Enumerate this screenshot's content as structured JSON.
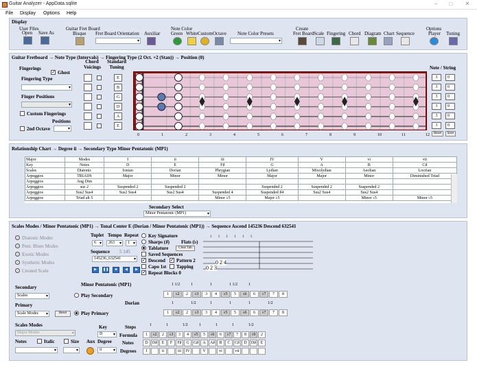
{
  "window": {
    "title": "Guitar Analyzer - AppData.sqlite"
  },
  "menu": [
    "File",
    "Display",
    "Options",
    "Help"
  ],
  "display": {
    "label": "Display",
    "user_files": "User Files",
    "open": "Open",
    "save_as": "Save As",
    "fretboard_group": "Guitar Fret Board",
    "bisque": "Bisque",
    "orientation": "Fret Board Orientation",
    "auxiliar": "Auxiliar",
    "note_color": "Note Color",
    "green": "Green",
    "white": "White",
    "custom": "Custom",
    "octave": "Octave",
    "presets": "Note Color Presets",
    "create": "Create",
    "create_fretboard": "Fret Board",
    "create_scale": "Scale",
    "create_fingering": "Fingering",
    "create_chord": "Chord",
    "create_diagram": "Diagram",
    "create_chart": "Chart",
    "create_sequence": "Sequence",
    "options": "Options",
    "player": "Player",
    "tuning": "Tuning"
  },
  "fretboard_header": "Guitar Fretboard → Note Type (Intervals) → Fingering Type (2 Oct. +2 (Stan)) → Position (0)",
  "fingerings": {
    "label": "Fingerings",
    "ghost": "Ghost",
    "type": "Fingering Type",
    "positions": "Finger Positions",
    "custom": "Custom Fingerings",
    "positions_lbl": "Positions",
    "second_octave": "2nd Octave"
  },
  "chord_voicings": "Chord Voicings",
  "standard_tuning": "Standard Tuning",
  "tuning_strings": [
    "E",
    "B",
    "G",
    "D",
    "A",
    "E"
  ],
  "note_string_lbl": "Note / String",
  "note_string": [
    [
      "3",
      "0"
    ],
    [
      "3",
      "0"
    ],
    [
      "3",
      "0"
    ],
    [
      "3",
      "0"
    ],
    [
      "3",
      "0"
    ],
    [
      "3",
      "0"
    ]
  ],
  "fret_numbers": [
    "0",
    "1",
    "2",
    "3",
    "4",
    "5",
    "6",
    "7",
    "8",
    "9",
    "10",
    "11",
    "12"
  ],
  "reset": "Reset",
  "save": "Save",
  "relationship_header": "Relationship Chart → Degree ii → Secondary Type Minor Pentatonic (MP1)",
  "rel_headers": [
    [
      "Major",
      "Modes",
      "I",
      "ii",
      "iii",
      "IV",
      "V",
      "vi",
      "vii"
    ],
    [
      "Key",
      "Notes",
      "D",
      "E",
      "F♯",
      "G",
      "A",
      "B",
      "C♯"
    ],
    [
      "Scales",
      "Diatonic",
      "Ionian",
      "Dorian",
      "Phrygian",
      "Lydian",
      "Mixolydian",
      "Aeolian",
      "Locrian"
    ]
  ],
  "rel_rows": [
    [
      "Arpeggios",
      "TRIADS",
      "Major",
      "Minor",
      "Minor",
      "Major",
      "Major",
      "Minor",
      "Diminished Triad"
    ],
    [
      "Arpeggios",
      "Aug Dim",
      "",
      "",
      "",
      "",
      "",
      "",
      ""
    ],
    [
      "Arpeggios",
      "sus 2",
      "Suspended 2",
      "Suspended 2",
      "",
      "Suspended 2",
      "Suspended 2",
      "Suspended 2",
      ""
    ],
    [
      "Arpeggios",
      "Sus2 Sus4",
      "Sus2 Sus4",
      "Sus2 Sus4",
      "Suspended 4",
      "Suspended ♯4",
      "Sus2 Sus4",
      "Sus2 Sus4",
      ""
    ],
    [
      "Arpeggios",
      "Triad alt 5",
      "",
      "",
      "Minor ♭5",
      "Major ♭5",
      "",
      "Minor ♭5",
      "Minor ♭5"
    ]
  ],
  "secondary_select": {
    "label": "Secondary Select",
    "value": "Minor Pentatonic (MP1)"
  },
  "scales_header": "Scales Modes / Minor Pentatonic (MP1) → Tonal Center E (Dorian / Minor Pentatonic (MP1)) → Sequence Ascend 145236 Descend 632541",
  "mode_types": [
    "Diatonic Modes",
    "Pent. Blues Modes",
    "Exotic Modes",
    "Synthetic Modes",
    "Created Scale"
  ],
  "tuplet": "Tuplet",
  "tempo": "Tempo",
  "repeat": "Repeat",
  "tuplet_val": "6",
  "tempo_val": "263",
  "repeat_val": "1",
  "sequence": "Sequence",
  "seq_nums": "5  145",
  "seq_value": "145236_632541",
  "options": {
    "key_signature": "Key Signature",
    "sharps": "Sharps (♯)",
    "flats": "Flats (♭)",
    "tablature": "Tablature",
    "clear_tab": "Clear Tab",
    "saved_seq": "Saved Sequences",
    "descend": "Descend",
    "pattern2": "Pattern 2",
    "capo": "Capo 1st",
    "tapping": "Tapping",
    "repeat_blocks": "Repeat Blocks 0"
  },
  "tab": {
    "top": "1 1 1 1 1 1",
    "line4": "0   2       4",
    "line5": "0       2   3"
  },
  "secondary": {
    "label": "Secondary",
    "scales": "Scales",
    "name": "Minor Pentatonic (MP1)",
    "play": "Play Secondary",
    "dorian": "Dorian"
  },
  "primary": {
    "label": "Primary",
    "mode": "Scale Modes",
    "reset": "Reset",
    "play": "Play Primary"
  },
  "scales_modes": {
    "label": "Scales Modes",
    "value": "Major Modes",
    "notes": "Notes",
    "italic": "Italic",
    "size": "Size",
    "aux": "Aux",
    "key": "Key",
    "key_val": "D",
    "degree": "Degree",
    "degree_val": "ii"
  },
  "steps": {
    "steps_lbl": "Steps",
    "formula_lbl": "Formula",
    "notes_lbl": "Notes",
    "degrees_lbl": "Degrees",
    "step_vals": [
      "1",
      "1",
      "1/2",
      "1",
      "1",
      "1",
      "1/2"
    ],
    "formula": [
      "1",
      "♭2",
      "2",
      "♭3",
      "3",
      "4",
      "♭5",
      "5",
      "♭6",
      "6",
      "♭7",
      "7",
      "8",
      "♭9",
      "2"
    ],
    "notes": [
      "D",
      "D♯",
      "E",
      "F",
      "F♯",
      "G",
      "G♯",
      "A",
      "A♯",
      "B",
      "C",
      "C♯",
      "D",
      "D♯",
      "E"
    ],
    "degrees": [
      "I",
      "",
      "ii",
      "",
      "iii",
      "IV",
      "",
      "V",
      "",
      "vi",
      "",
      "vii",
      "",
      "",
      ""
    ]
  },
  "sec_steps": {
    "top": [
      "1 1/2",
      "1",
      "1",
      "1 1/2",
      "1"
    ],
    "formula": [
      "1",
      "♭2",
      "2",
      "♭3",
      "3",
      "4",
      "♭5",
      "5",
      "♭6",
      "6",
      "♭7",
      "7",
      "8"
    ]
  },
  "pri_steps": {
    "top": [
      "1",
      "1/2",
      "1",
      "1",
      "1",
      "1/2"
    ],
    "formula": [
      "1",
      "♭2",
      "2",
      "♭3",
      "3",
      "4",
      "♭5",
      "5",
      "♭6",
      "6",
      "♭7",
      "7",
      "8"
    ]
  }
}
